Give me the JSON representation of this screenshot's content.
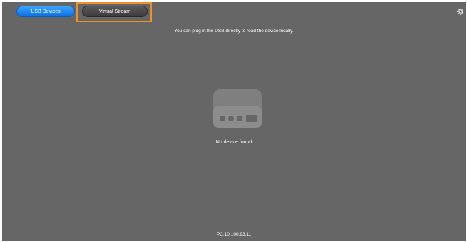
{
  "tabs": {
    "usb_devices": "USB Devices",
    "virtual_stream": "Virtual Stream",
    "active": "usb_devices"
  },
  "hint": "You can plug in the USB directly to read the device locally.",
  "status": "No device found",
  "footer": "PC:10.100.93.11",
  "icons": {
    "settings": "gear-icon",
    "device": "storage-device-icon"
  },
  "colors": {
    "background": "#666666",
    "active_tab": "#1a86f5",
    "inactive_tab": "#4a4a4a",
    "highlight": "#f0902a"
  }
}
